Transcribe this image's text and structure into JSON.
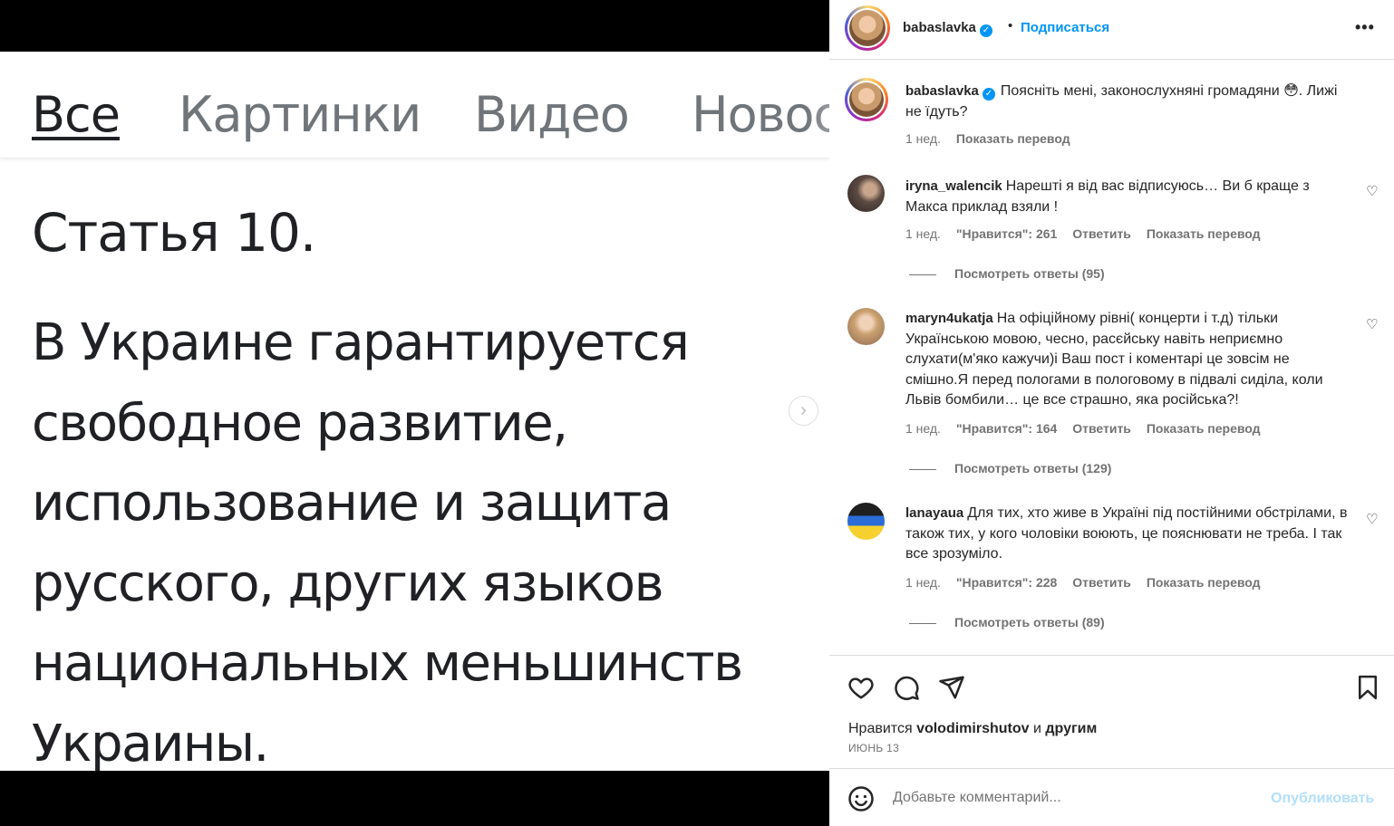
{
  "media": {
    "tabs": [
      "Все",
      "Картинки",
      "Видео",
      "Новости"
    ],
    "article_title": "Статья 10.",
    "article_body": "В Украине гарантируется свободное развитие, использование и защита русского, других языков национальных меньшинств Украины."
  },
  "header": {
    "username": "babaslavka",
    "separator": "•",
    "follow_label": "Подписаться",
    "more_label": "•••"
  },
  "caption": {
    "username": "babaslavka",
    "text": "Поясніть мені, законослухняні громадяни 😳. Лижі не їдуть?",
    "time": "1 нед.",
    "translate": "Показать перевод"
  },
  "comments": [
    {
      "username": "iryna_walencik",
      "text": "Нарешті я від вас відписуюсь… Ви б краще з Макса приклад взяли !",
      "time": "1 нед.",
      "likes": "\"Нравится\": 261",
      "reply": "Ответить",
      "translate": "Показать перевод",
      "view_replies": "Посмотреть ответы (95)"
    },
    {
      "username": "maryn4ukatja",
      "text": "На офіційному рівні( концерти і т.д) тільки Українською мовою, чесно, расєйську навіть неприємно слухати(м'яко кажучи)і Ваш пост і коментарі це зовсім не смішно.Я перед пологами в пологовому в підвалі сиділа, коли Львів бомбили… це все страшно, яка російська?!",
      "time": "1 нед.",
      "likes": "\"Нравится\": 164",
      "reply": "Ответить",
      "translate": "Показать перевод",
      "view_replies": "Посмотреть ответы (129)"
    },
    {
      "username": "lanayaua",
      "text": "Для тих, хто живе в Україні під постійними обстрілами, в також тих, у кого чоловіки воюють, це пояснювати не треба. І так все зрозуміло.",
      "time": "1 нед.",
      "likes": "\"Нравится\": 228",
      "reply": "Ответить",
      "translate": "Показать перевод",
      "view_replies": "Посмотреть ответы (89)"
    }
  ],
  "likes": {
    "prefix": "Нравится",
    "user": "volodimirshutov",
    "conj": "и",
    "others": "другим"
  },
  "post_date": "ИЮНЬ 13",
  "add_comment": {
    "placeholder": "Добавьте комментарий...",
    "publish_label": "Опубликовать"
  },
  "colors": {
    "accent": "#0095f6",
    "publish_disabled": "#b2dffc",
    "secondary_text": "#737373"
  },
  "icons": [
    "verified-badge-icon",
    "more-options-icon",
    "heart-icon",
    "comment-icon",
    "share-icon",
    "bookmark-icon",
    "emoji-icon",
    "chevron-right-icon"
  ]
}
